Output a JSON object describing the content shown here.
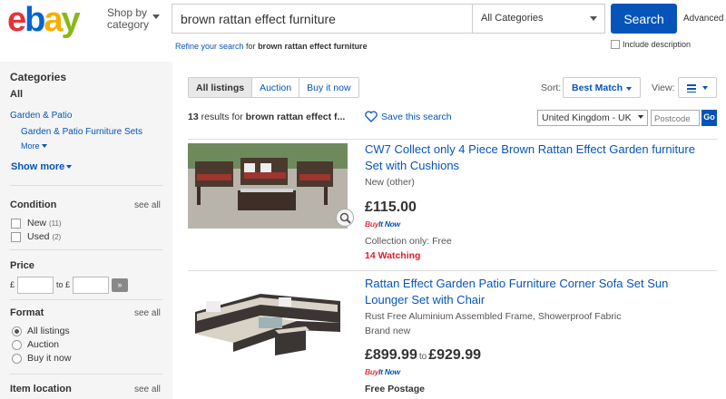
{
  "header": {
    "shop_by": "Shop by",
    "shop_by_2": "category",
    "search_value": "brown rattan effect furniture",
    "category": "All Categories",
    "search_button": "Search",
    "advanced": "Advanced",
    "refine_link": "Refine your search",
    "refine_for": " for ",
    "refine_term": "brown rattan effect furniture",
    "include_description": "Include description"
  },
  "sidebar": {
    "categories_title": "Categories",
    "all": "All",
    "cat1": "Garden & Patio",
    "cat2": "Garden & Patio Furniture Sets",
    "more": "More",
    "show_more": "Show more",
    "condition_title": "Condition",
    "see_all": "see all",
    "conditions": [
      {
        "label": "New",
        "count": "(11)"
      },
      {
        "label": "Used",
        "count": "(2)"
      }
    ],
    "price_title": "Price",
    "currency": "£",
    "to": "to",
    "format_title": "Format",
    "formats": [
      "All listings",
      "Auction",
      "Buy it now"
    ],
    "location_title": "Item location"
  },
  "toolbar": {
    "tabs": [
      "All listings",
      "Auction",
      "Buy it now"
    ],
    "sort_label": "Sort:",
    "sort_value": "Best Match",
    "view_label": "View:",
    "results_count": "13",
    "results_text": " results for ",
    "results_term": "brown rattan effect f...",
    "save_search": "Save this search",
    "country": "United Kingdom - UK",
    "postcode_placeholder": "Postcode",
    "go": "Go"
  },
  "items": [
    {
      "title": "CW7 Collect only 4 Piece Brown Rattan Effect Garden furniture Set with Cushions",
      "condition": "New (other)",
      "price": "£115.00",
      "buy_it_now_1": "Buy",
      "buy_it_now_2": "It Now",
      "shipping": "Collection only: Free",
      "watching": "14 Watching"
    },
    {
      "title": "Rattan Effect Garden Patio Furniture Corner Sofa Set Sun Lounger Set with Chair",
      "subtitle": "Rust Free Aluminium Assembled Frame, Showerproof Fabric",
      "condition": "Brand new",
      "price_low": "£899.99",
      "price_to": "to",
      "price_high": "£929.99",
      "buy_it_now_1": "Buy",
      "buy_it_now_2": "It Now",
      "shipping": "Free Postage"
    }
  ],
  "colors": {
    "link": "#0654ba",
    "watching": "#dd1e31",
    "sidebar_bg": "#f5f5f5"
  }
}
